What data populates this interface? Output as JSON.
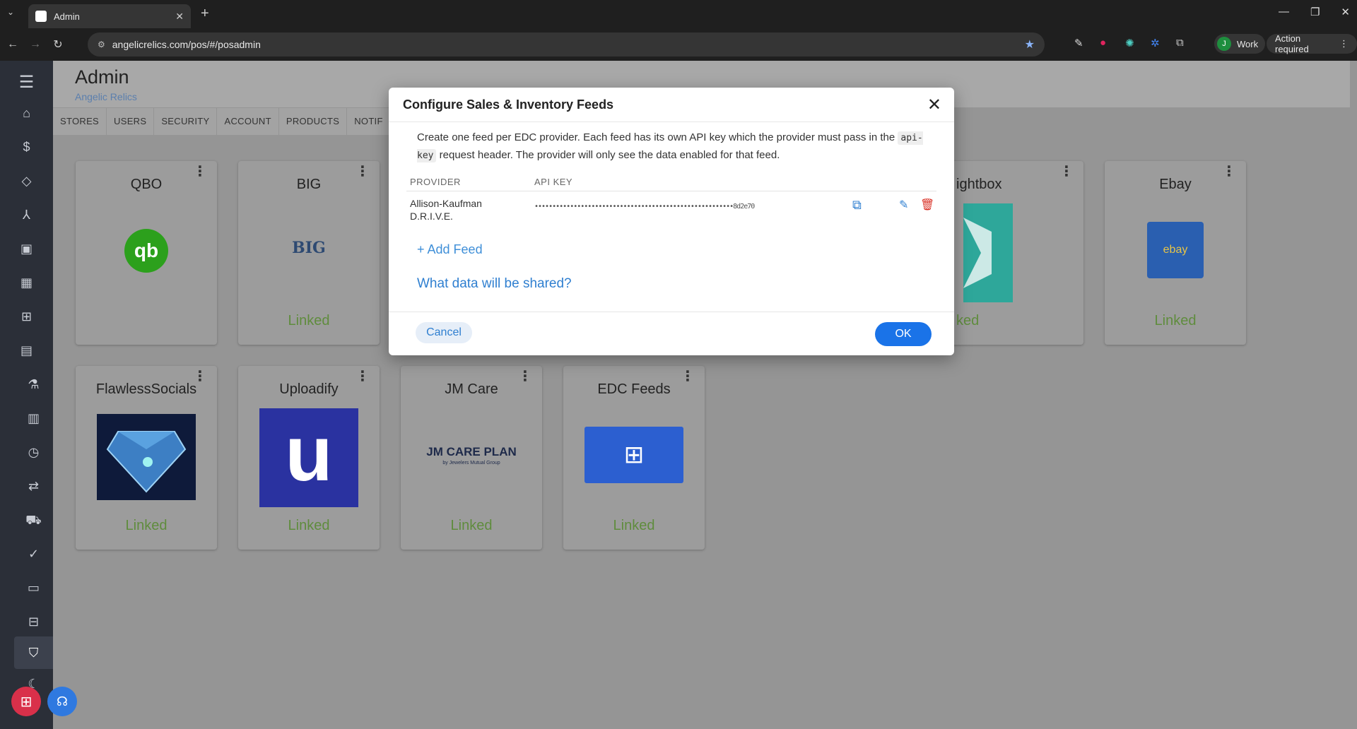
{
  "browser": {
    "tab_title": "Admin",
    "url": "angelicrelics.com/pos/#/posadmin",
    "profile_label": "Work",
    "profile_initial": "J",
    "action_required": "Action required"
  },
  "header": {
    "title": "Admin",
    "subtitle": "Angelic Relics"
  },
  "tabs": [
    "STORES",
    "USERS",
    "SECURITY",
    "ACCOUNT",
    "PRODUCTS",
    "NOTIF"
  ],
  "cards": [
    {
      "name": "QBO",
      "status": ""
    },
    {
      "name": "BIG",
      "status": "Linked",
      "logo_text": "BIG"
    },
    {
      "name": "Lightbox",
      "name_visible": "ightbox",
      "status_visible": "ked"
    },
    {
      "name": "Ebay",
      "status": "Linked",
      "logo_text": "ebay"
    },
    {
      "name": "FlawlessSocials",
      "status": "Linked"
    },
    {
      "name": "Uploadify",
      "status": "Linked",
      "logo_text": "u"
    },
    {
      "name": "JM Care",
      "status": "Linked",
      "logo_text": "JM CARE PLAN",
      "logo_subtext": "by Jewelers Mutual Group"
    },
    {
      "name": "EDC Feeds",
      "status": "Linked"
    }
  ],
  "modal": {
    "title": "Configure Sales & Inventory Feeds",
    "desc_part1": "Create one feed per EDC provider. Each feed has its own API key which the provider must pass in the",
    "desc_code": "api-key",
    "desc_part2": "request header. The provider will only see the data enabled for that feed.",
    "col_provider": "PROVIDER",
    "col_apikey": "API KEY",
    "feeds": [
      {
        "provider": "Allison-Kaufman D.R.I.V.E.",
        "api_key": "••••••••••••••••••••••••••••••••••••••••••••••••••••••••8d2e70"
      }
    ],
    "add_feed": "+ Add Feed",
    "what_data": "What data will be shared?",
    "cancel": "Cancel",
    "ok": "OK"
  },
  "colors": {
    "primary": "#1a73e8",
    "link": "#2f7fd0",
    "linked_green": "#5f8c3d",
    "delete_red": "#d93025"
  }
}
